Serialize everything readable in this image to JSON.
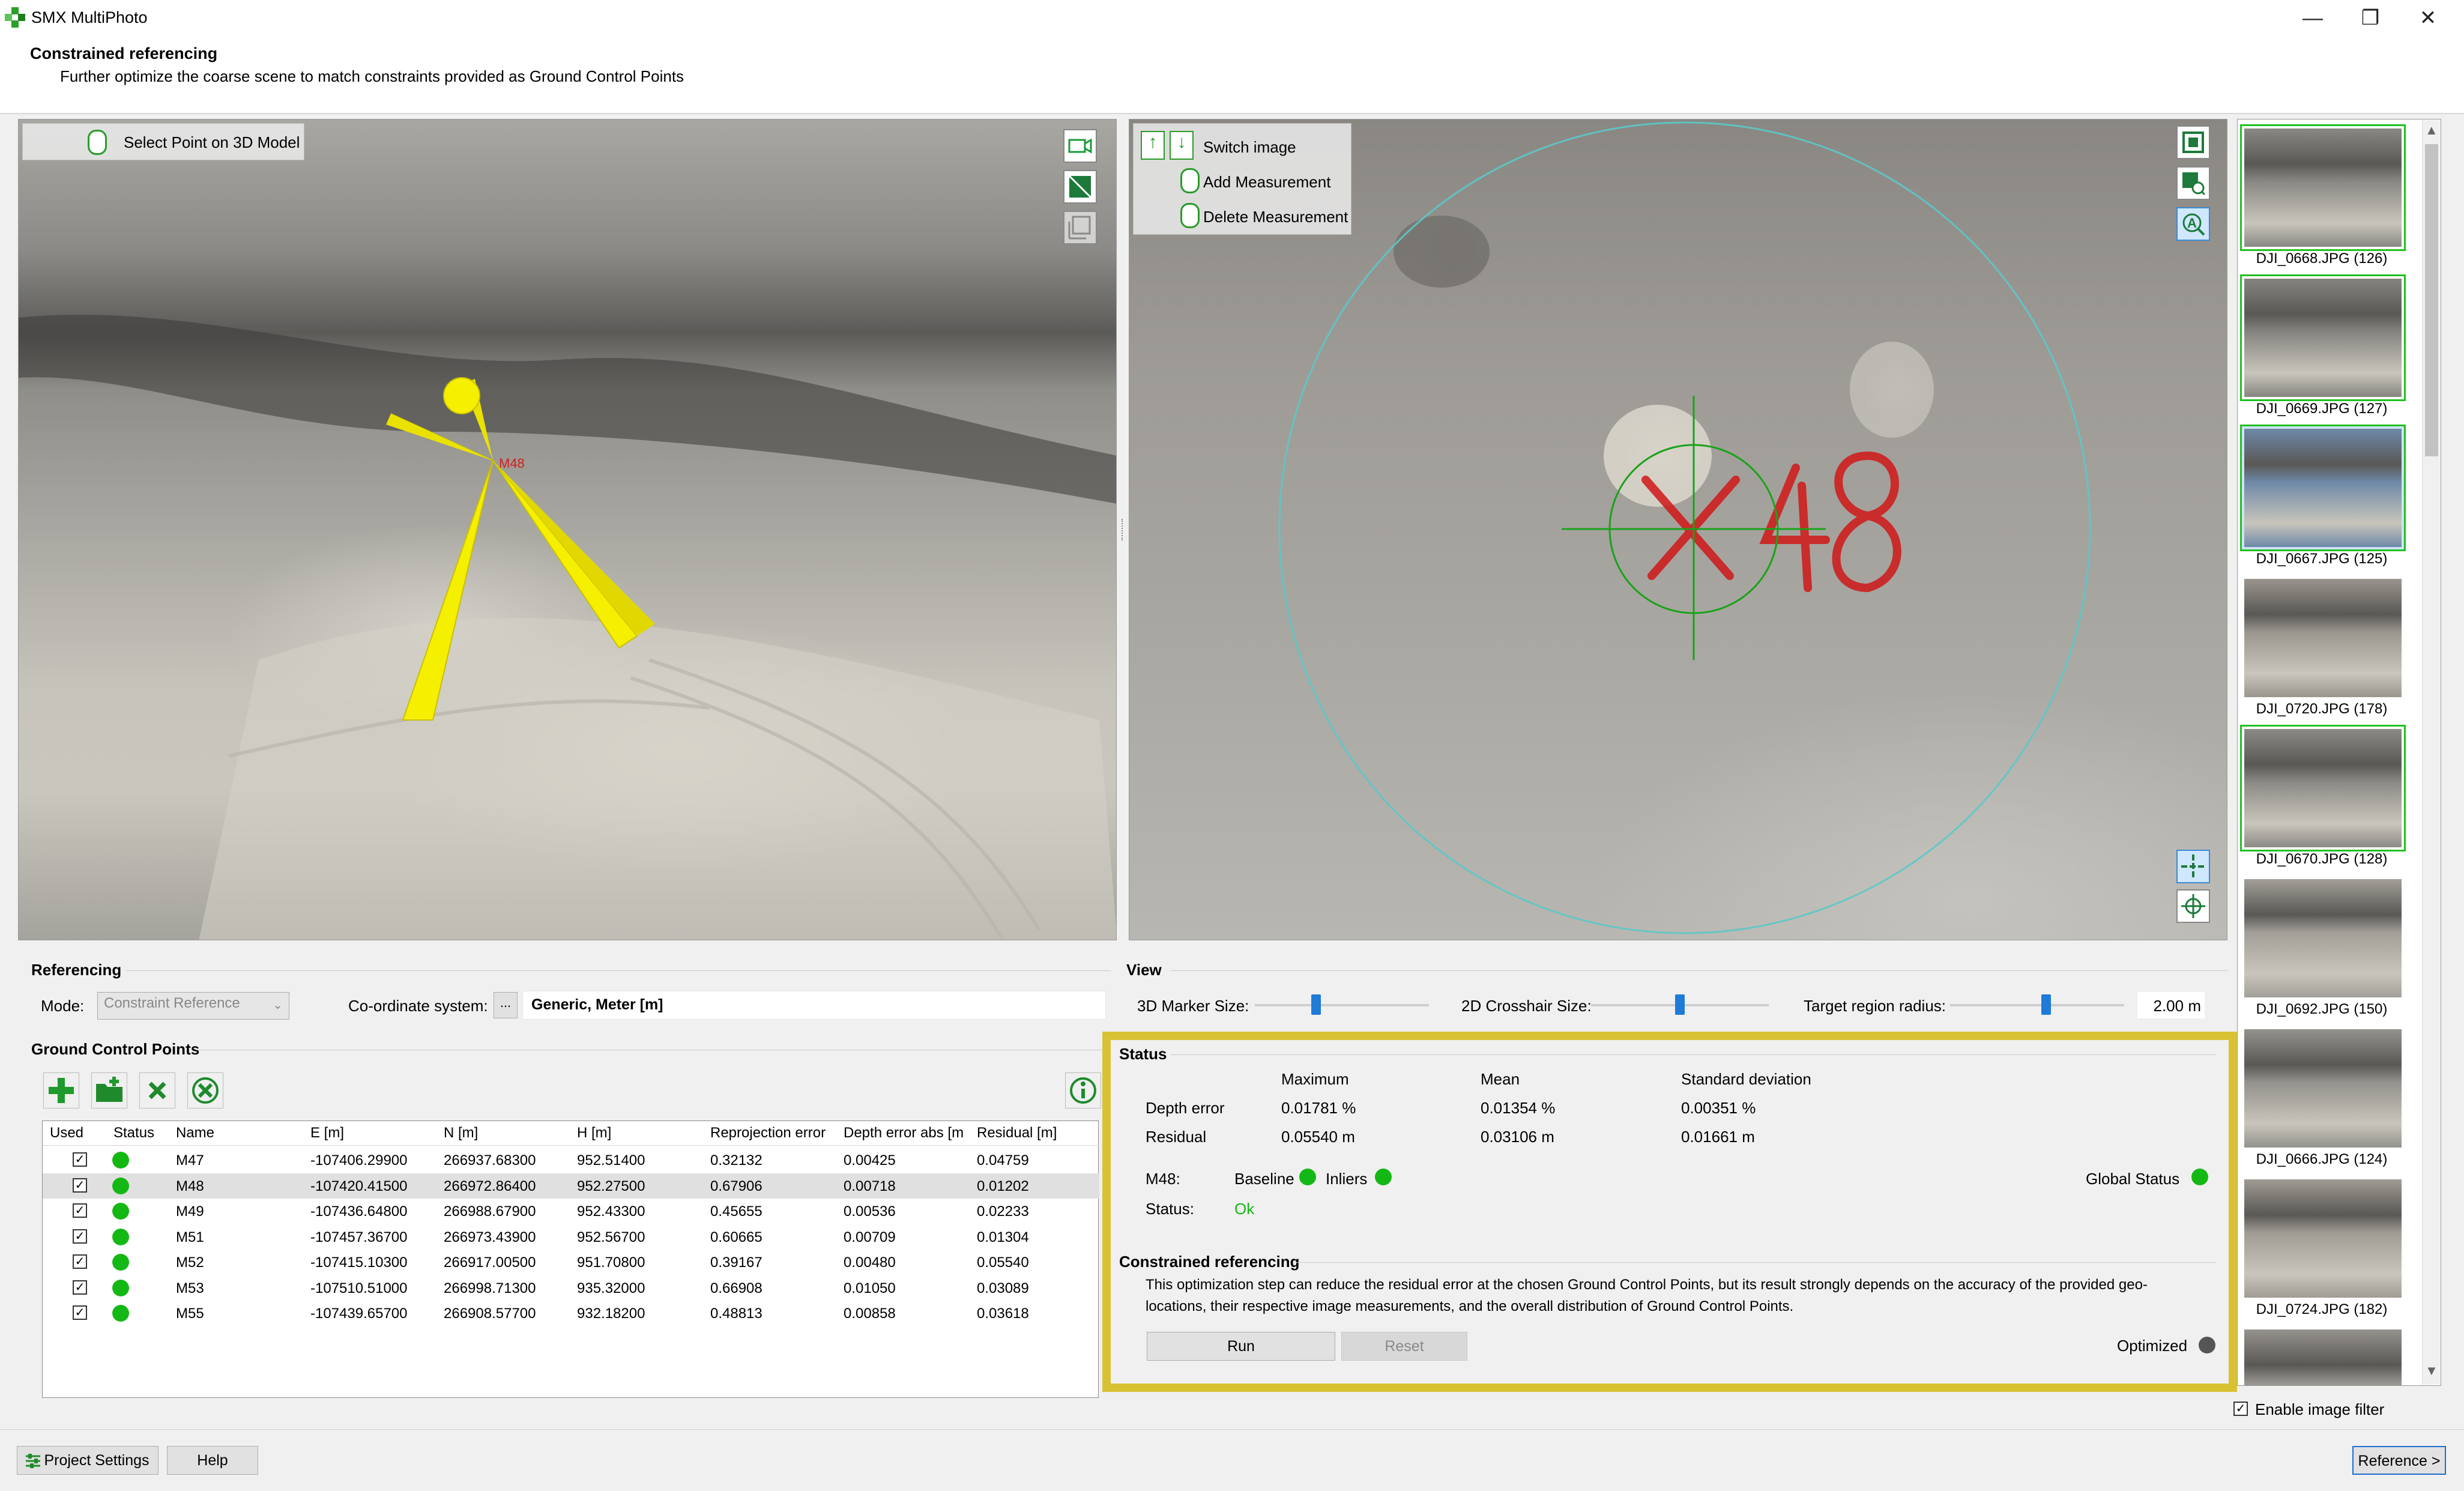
{
  "window": {
    "title": "SMX MultiPhoto",
    "controls": {
      "minimize": "—",
      "maximize": "❐",
      "close": "✕"
    }
  },
  "header": {
    "title": "Constrained referencing",
    "description": "Further optimize the coarse scene to match constraints provided as Ground Control Points"
  },
  "viewport3d": {
    "hint_label": "Select Point on 3D Model"
  },
  "viewport2d": {
    "hints": {
      "switch_image": "Switch image",
      "add_measurement": "Add Measurement",
      "delete_measurement": "Delete Measurement"
    },
    "marker_label": "M48"
  },
  "thumbnails": [
    {
      "label": "DJI_0668.JPG (126)",
      "state": "green",
      "tone": "#8a8884"
    },
    {
      "label": "DJI_0669.JPG (127)",
      "state": "green",
      "tone": "#868480"
    },
    {
      "label": "DJI_0667.JPG (125)",
      "state": "selected",
      "tone": "#6d89a8"
    },
    {
      "label": "DJI_0720.JPG (178)",
      "state": "normal",
      "tone": "#9a968e"
    },
    {
      "label": "DJI_0670.JPG (128)",
      "state": "green",
      "tone": "#8c8a85"
    },
    {
      "label": "DJI_0692.JPG (150)",
      "state": "normal",
      "tone": "#a29f98"
    },
    {
      "label": "DJI_0666.JPG (124)",
      "state": "normal",
      "tone": "#94928d"
    },
    {
      "label": "DJI_0724.JPG (182)",
      "state": "normal",
      "tone": "#a09c94"
    },
    {
      "label": "",
      "state": "normal",
      "tone": "#96938e"
    }
  ],
  "referencing": {
    "section_label": "Referencing",
    "mode_label": "Mode:",
    "mode_value": "Constraint Reference",
    "coord_label": "Co-ordinate system:",
    "coord_button": "...",
    "coord_value": "Generic, Meter [m]"
  },
  "view": {
    "section_label": "View",
    "marker_size_label": "3D Marker Size:",
    "marker_size_level": 0.35,
    "crosshair_label": "2D Crosshair Size:",
    "crosshair_level": 0.5,
    "target_radius_label": "Target region radius:",
    "target_radius_level": 0.55,
    "target_radius_value": "2.00 m"
  },
  "gcp": {
    "section_label": "Ground Control Points",
    "columns": [
      "Used",
      "Status",
      "Name",
      "E [m]",
      "N [m]",
      "H [m]",
      "Reprojection error",
      "Depth error abs [m",
      "Residual [m]"
    ],
    "rows": [
      {
        "name": "M47",
        "e": "-107406.29900",
        "n": "266937.68300",
        "h": "952.51400",
        "reproj": "0.32132",
        "depth": "0.00425",
        "residual": "0.04759",
        "selected": false
      },
      {
        "name": "M48",
        "e": "-107420.41500",
        "n": "266972.86400",
        "h": "952.27500",
        "reproj": "0.67906",
        "depth": "0.00718",
        "residual": "0.01202",
        "selected": true
      },
      {
        "name": "M49",
        "e": "-107436.64800",
        "n": "266988.67900",
        "h": "952.43300",
        "reproj": "0.45655",
        "depth": "0.00536",
        "residual": "0.02233",
        "selected": false
      },
      {
        "name": "M51",
        "e": "-107457.36700",
        "n": "266973.43900",
        "h": "952.56700",
        "reproj": "0.60665",
        "depth": "0.00709",
        "residual": "0.01304",
        "selected": false
      },
      {
        "name": "M52",
        "e": "-107415.10300",
        "n": "266917.00500",
        "h": "951.70800",
        "reproj": "0.39167",
        "depth": "0.00480",
        "residual": "0.05540",
        "selected": false
      },
      {
        "name": "M53",
        "e": "-107510.51000",
        "n": "266998.71300",
        "h": "935.32000",
        "reproj": "0.66908",
        "depth": "0.01050",
        "residual": "0.03089",
        "selected": false
      },
      {
        "name": "M55",
        "e": "-107439.65700",
        "n": "266908.57700",
        "h": "932.18200",
        "reproj": "0.48813",
        "depth": "0.00858",
        "residual": "0.03618",
        "selected": false
      }
    ],
    "check_mark": "✓"
  },
  "status": {
    "section_label": "Status",
    "col_max": "Maximum",
    "col_mean": "Mean",
    "col_std": "Standard deviation",
    "depth_label": "Depth error",
    "depth_max": "0.01781 %",
    "depth_mean": "0.01354 %",
    "depth_std": "0.00351 %",
    "residual_label": "Residual",
    "residual_max": "0.05540 m",
    "residual_mean": "0.03106 m",
    "residual_std": "0.01661 m",
    "point_label": "M48:",
    "baseline_label": "Baseline",
    "inliers_label": "Inliers",
    "global_label": "Global Status",
    "status_label": "Status:",
    "status_value": "Ok",
    "colors": {
      "ok": "#14b814",
      "pending": "#555555",
      "accent": "#d8c234"
    }
  },
  "constrained": {
    "section_label": "Constrained referencing",
    "description_line1": "This optimization step can reduce the residual error at the chosen Ground Control Points, but its result strongly depends on the accuracy of the provided geo-",
    "description_line2": "locations, their respective image measurements, and the overall distribution of Ground Control Points.",
    "run_label": "Run",
    "reset_label": "Reset",
    "optimized_label": "Optimized"
  },
  "footer": {
    "enable_filter_label": "Enable image filter",
    "project_settings_label": "Project Settings",
    "help_label": "Help",
    "next_label": "Reference >"
  }
}
